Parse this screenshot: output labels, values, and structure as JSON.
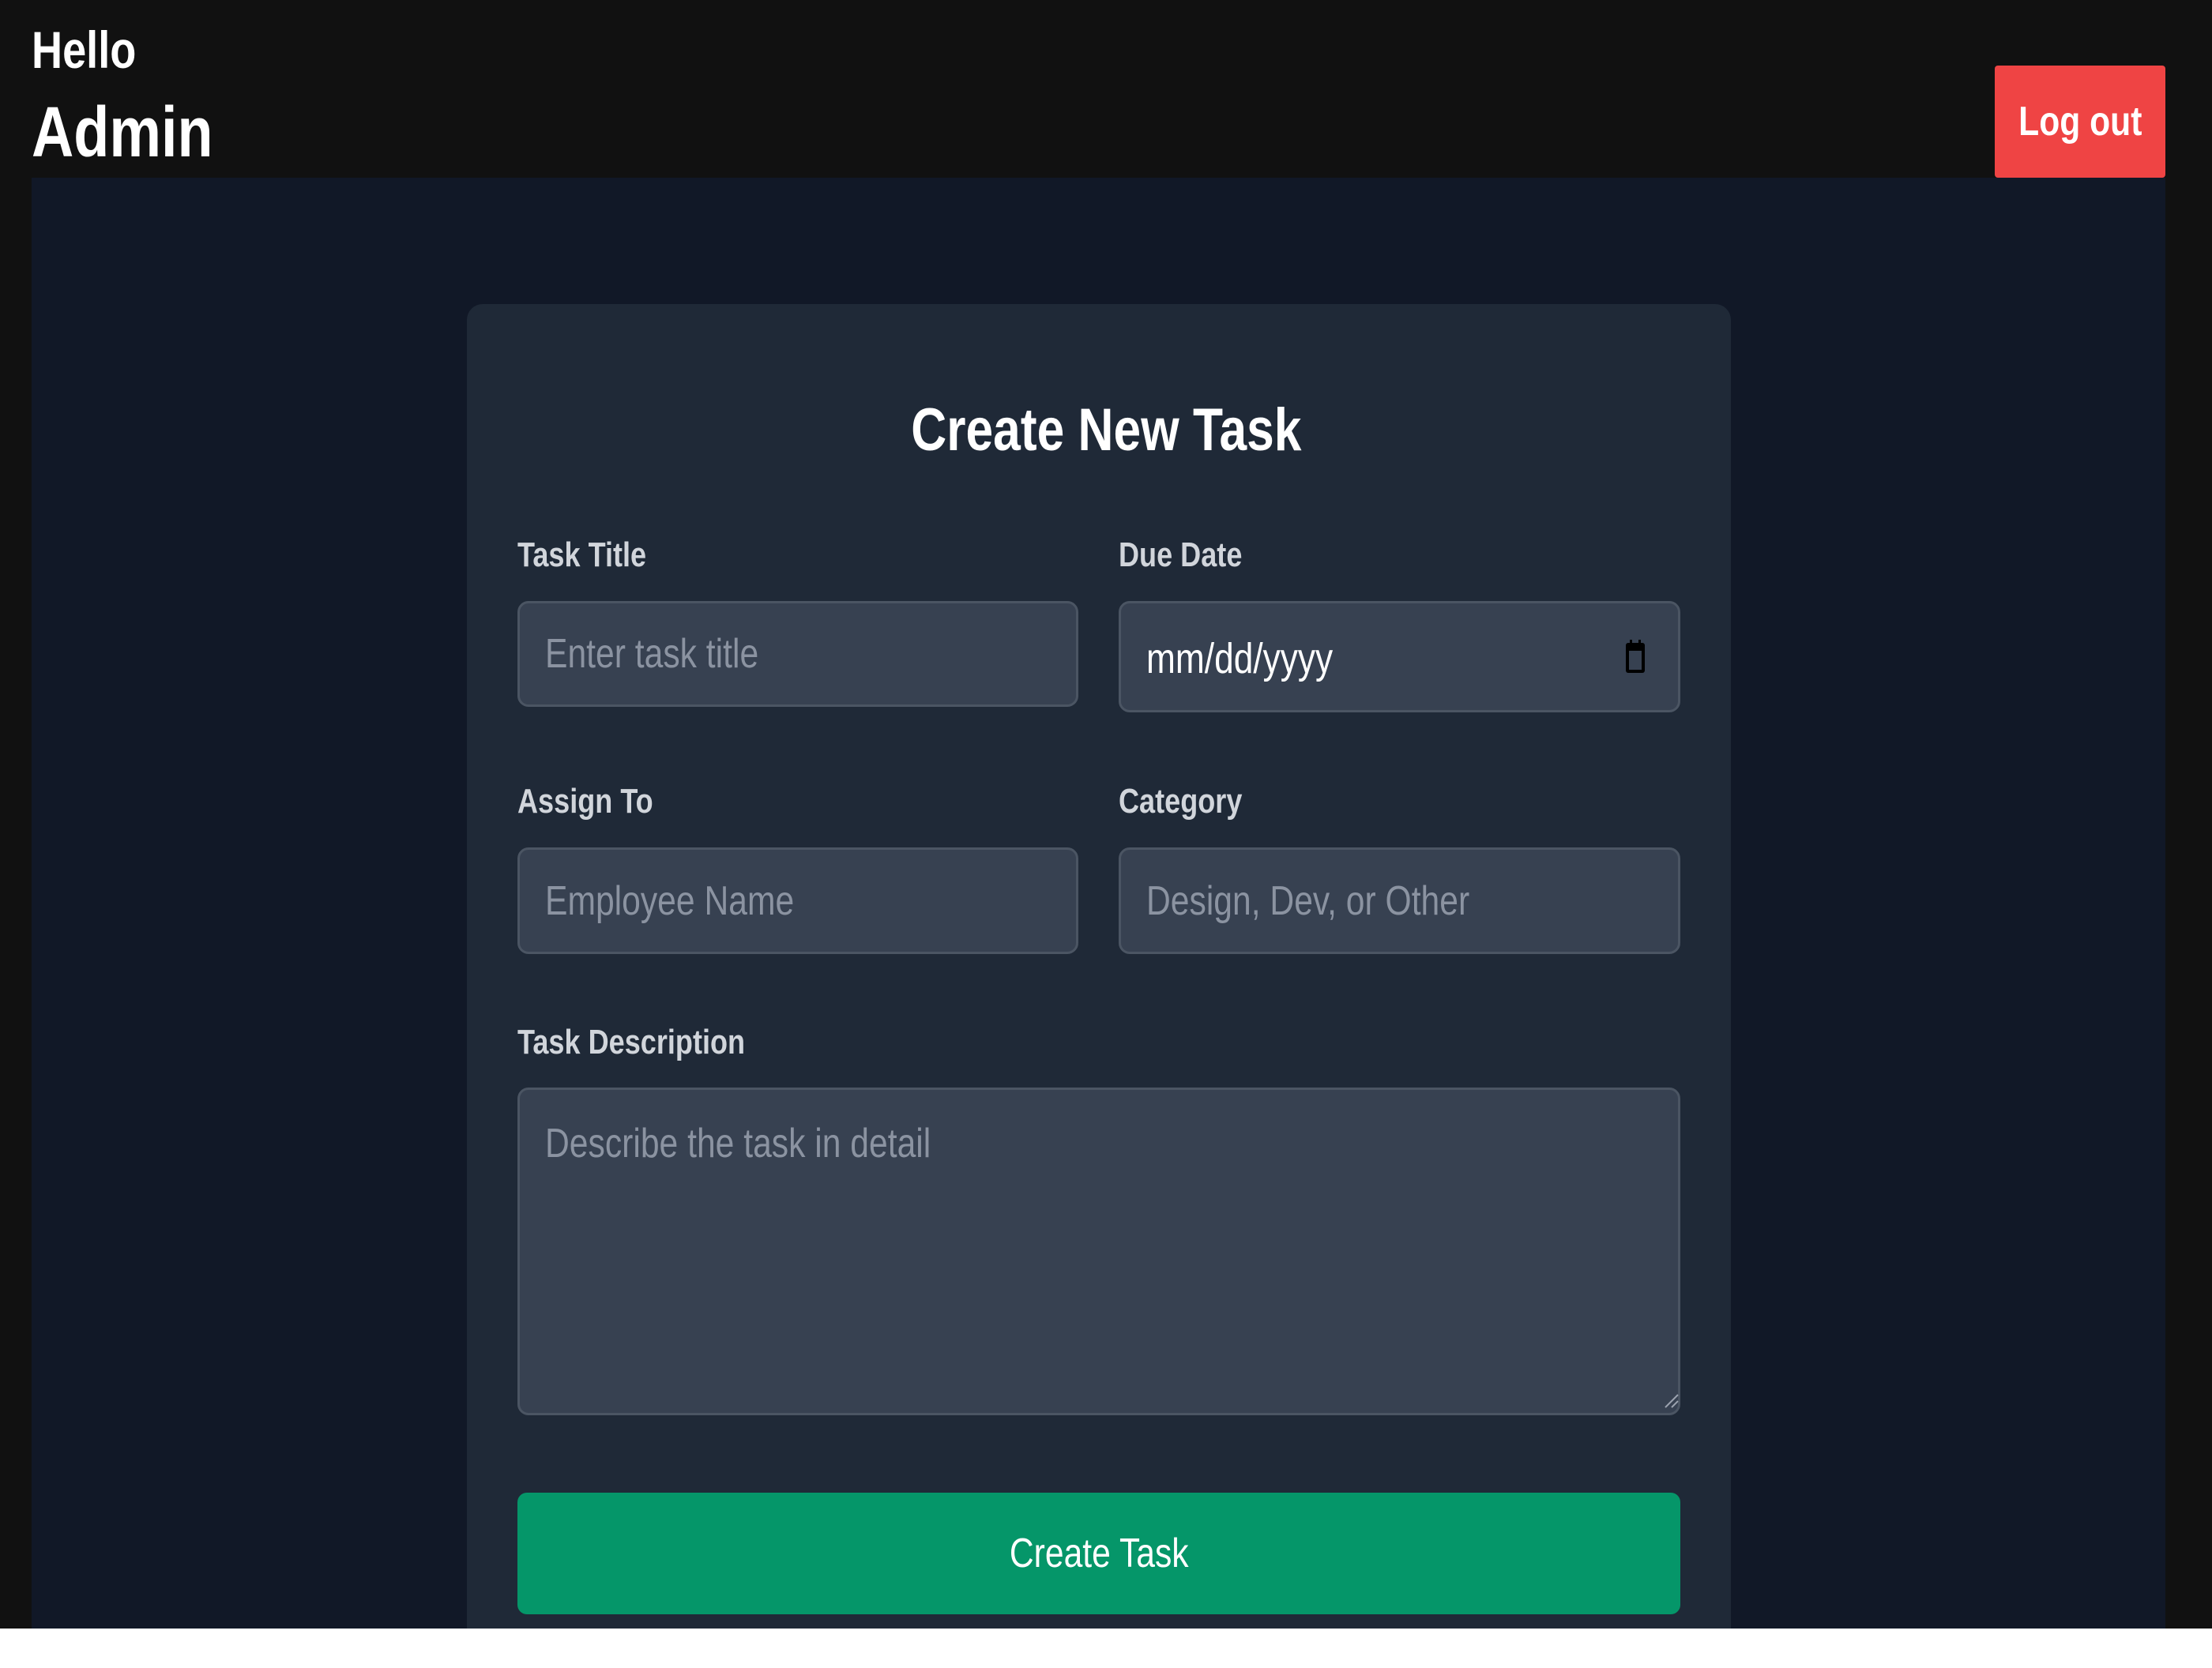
{
  "header": {
    "greeting": "Hello",
    "user_name": "Admin",
    "logout_label": "Log out"
  },
  "form": {
    "title": "Create New Task",
    "task_title": {
      "label": "Task Title",
      "placeholder": "Enter task title",
      "value": ""
    },
    "due_date": {
      "label": "Due Date",
      "value": "mm/dd/yyyy"
    },
    "assign_to": {
      "label": "Assign To",
      "placeholder": "Employee Name",
      "value": ""
    },
    "category": {
      "label": "Category",
      "placeholder": "Design, Dev, or Other",
      "value": ""
    },
    "description": {
      "label": "Task Description",
      "placeholder": "Describe the task in detail",
      "value": ""
    },
    "submit_label": "Create Task"
  },
  "colors": {
    "page_bg": "#111111",
    "panel_bg": "#111827",
    "card_bg": "#1f2937",
    "input_bg": "#374151",
    "logout": "#ef4444",
    "submit": "#059669"
  },
  "icons": {
    "calendar": "calendar-icon",
    "resize": "resize-handle-icon"
  }
}
